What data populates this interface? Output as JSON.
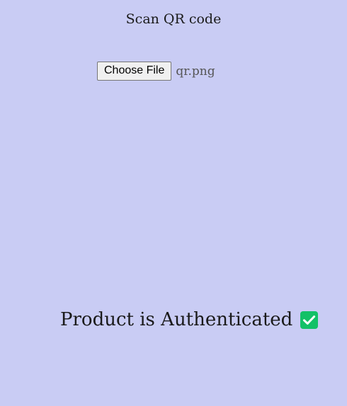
{
  "title": "Scan QR code",
  "file_input": {
    "button_label": "Choose File",
    "file_name": "qr.png"
  },
  "status": {
    "message": "Product is Authenticated",
    "icon": "check-mark-icon",
    "icon_color": "#12c167"
  },
  "colors": {
    "background": "#c9ccf4"
  }
}
